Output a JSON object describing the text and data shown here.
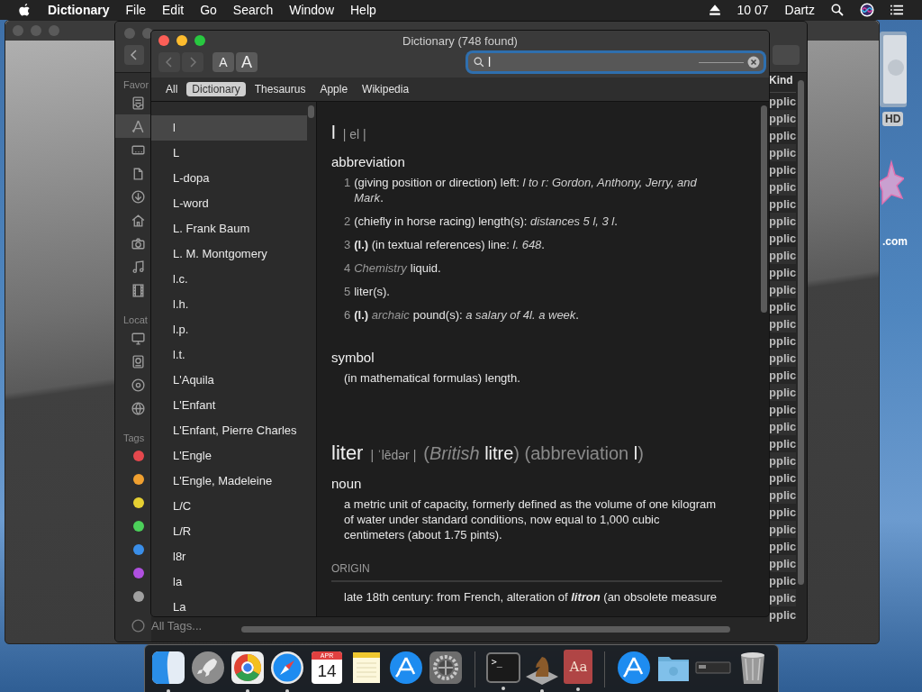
{
  "menu_bar": {
    "app_name": "Dictionary",
    "menus": [
      "File",
      "Edit",
      "Go",
      "Search",
      "Window",
      "Help"
    ],
    "time": "10 07",
    "user": "Dartz"
  },
  "desktop": {
    "labels": [
      "HD",
      ".com"
    ]
  },
  "finder": {
    "sections": [
      {
        "label": "Favor",
        "items": [
          {
            "selected": false
          },
          {
            "selected": true
          },
          {
            "selected": false
          },
          {
            "selected": false
          },
          {
            "selected": false
          },
          {
            "selected": false
          },
          {
            "selected": false
          },
          {
            "selected": false
          },
          {
            "selected": false
          }
        ]
      },
      {
        "label": "Locat",
        "items": [
          {
            "selected": false
          },
          {
            "selected": false
          },
          {
            "selected": false
          },
          {
            "selected": false
          }
        ]
      }
    ],
    "tags_label": "Tags",
    "tags": [
      {
        "color": "#e5484d"
      },
      {
        "color": "#f0a030"
      },
      {
        "color": "#e6d032"
      },
      {
        "color": "#4cd05a"
      },
      {
        "color": "#3a8ee8"
      },
      {
        "color": "#b050e0"
      },
      {
        "color": "#a0a0a0"
      }
    ],
    "all_tags": "All Tags...",
    "column_header": "Kind",
    "kind_cells": [
      "pplic",
      "pplic",
      "pplic",
      "pplic",
      "pplic",
      "pplic",
      "pplic",
      "pplic",
      "pplic",
      "pplic",
      "pplic",
      "pplic",
      "pplic",
      "pplic",
      "pplic",
      "pplic",
      "pplic",
      "pplic",
      "pplic",
      "pplic",
      "pplic",
      "pplic",
      "pplic",
      "pplic",
      "pplic",
      "pplic",
      "pplic",
      "pplic",
      "pplic",
      "pplic",
      "pplic"
    ]
  },
  "dictionary": {
    "title": "Dictionary (748 found)",
    "nav_buttons": [
      {
        "disabled": true
      },
      {
        "disabled": true
      }
    ],
    "font_buttons": [
      "A",
      "A"
    ],
    "search": {
      "value": "l"
    },
    "scopes": [
      {
        "label": "All",
        "selected": false
      },
      {
        "label": "Dictionary",
        "selected": true
      },
      {
        "label": "Thesaurus",
        "selected": false
      },
      {
        "label": "Apple",
        "selected": false
      },
      {
        "label": "Wikipedia",
        "selected": false
      }
    ],
    "results": [
      {
        "label": "l",
        "selected": true
      },
      {
        "label": "L",
        "selected": false
      },
      {
        "label": "L-dopa",
        "selected": false
      },
      {
        "label": "L-word",
        "selected": false
      },
      {
        "label": "L. Frank Baum",
        "selected": false
      },
      {
        "label": "L. M. Montgomery",
        "selected": false
      },
      {
        "label": "l.c.",
        "selected": false
      },
      {
        "label": "l.h.",
        "selected": false
      },
      {
        "label": "l.p.",
        "selected": false
      },
      {
        "label": "l.t.",
        "selected": false
      },
      {
        "label": "L'Aquila",
        "selected": false
      },
      {
        "label": "L'Enfant",
        "selected": false
      },
      {
        "label": "L'Enfant, Pierre Charles",
        "selected": false
      },
      {
        "label": "L'Engle",
        "selected": false
      },
      {
        "label": "L'Engle, Madeleine",
        "selected": false
      },
      {
        "label": "L/C",
        "selected": false
      },
      {
        "label": "L/R",
        "selected": false
      },
      {
        "label": "l8r",
        "selected": false
      },
      {
        "label": "la",
        "selected": false
      },
      {
        "label": "La",
        "selected": false
      }
    ],
    "entries": [
      {
        "headword": "l",
        "pronunciation": "| el |",
        "sections": [
          {
            "part": "abbreviation",
            "senses": [
              {
                "number": "1",
                "text": "(giving position or direction) left: *l to r: Gordon, Anthony, Jerry, and Mark*."
              },
              {
                "number": "2",
                "text": "(chiefly in horse racing) length(s): *distances 5 l, 3 l*."
              },
              {
                "number": "3",
                "prefix": "**(l.)**",
                "text": "(in textual references) line: *l. 648*."
              },
              {
                "number": "4",
                "label": "Chemistry",
                "text": "liquid."
              },
              {
                "number": "5",
                "text": "liter(s)."
              },
              {
                "number": "6",
                "prefix": "**(l.)**",
                "label": "archaic",
                "text": "pound(s): *a salary of 4l. a week*."
              }
            ]
          },
          {
            "part": "symbol",
            "senses": [
              {
                "text": "(in mathematical formulas) length."
              }
            ]
          }
        ]
      },
      {
        "headword": "liter",
        "pronunciation": "| ˈlēdər |",
        "variants": "(*British* **litre**) (abbreviation **l**)",
        "sections": [
          {
            "part": "noun",
            "senses": [
              {
                "text": "a metric unit of capacity, formerly defined as the volume of one kilogram of water under standard conditions, now equal to 1,000 cubic centimeters (about 1.75 pints)."
              }
            ]
          }
        ],
        "origin": {
          "label": "ORIGIN",
          "text": "late 18th century: from French, alteration of **litron** (an obsolete measure"
        }
      }
    ]
  },
  "dock": {
    "groups": [
      [
        {
          "kind": "tile",
          "running": true
        },
        {
          "kind": "rocket",
          "running": false
        },
        {
          "kind": "ring",
          "running": true
        },
        {
          "kind": "compass",
          "running": true
        },
        {
          "kind": "calendar",
          "month": "APR",
          "day": "14",
          "running": false
        },
        {
          "kind": "notepad",
          "running": false
        },
        {
          "kind": "store",
          "running": false
        },
        {
          "kind": "gear",
          "running": false
        }
      ],
      [
        {
          "kind": "terminal",
          "glyph": ">_",
          "running": true
        },
        {
          "kind": "chess",
          "running": true
        },
        {
          "kind": "book",
          "glyph": "Aa",
          "running": true
        }
      ],
      [
        {
          "kind": "store",
          "running": false
        },
        {
          "kind": "folder",
          "running": false
        },
        {
          "kind": "drive",
          "running": false
        },
        {
          "kind": "trash",
          "running": false
        }
      ]
    ]
  }
}
